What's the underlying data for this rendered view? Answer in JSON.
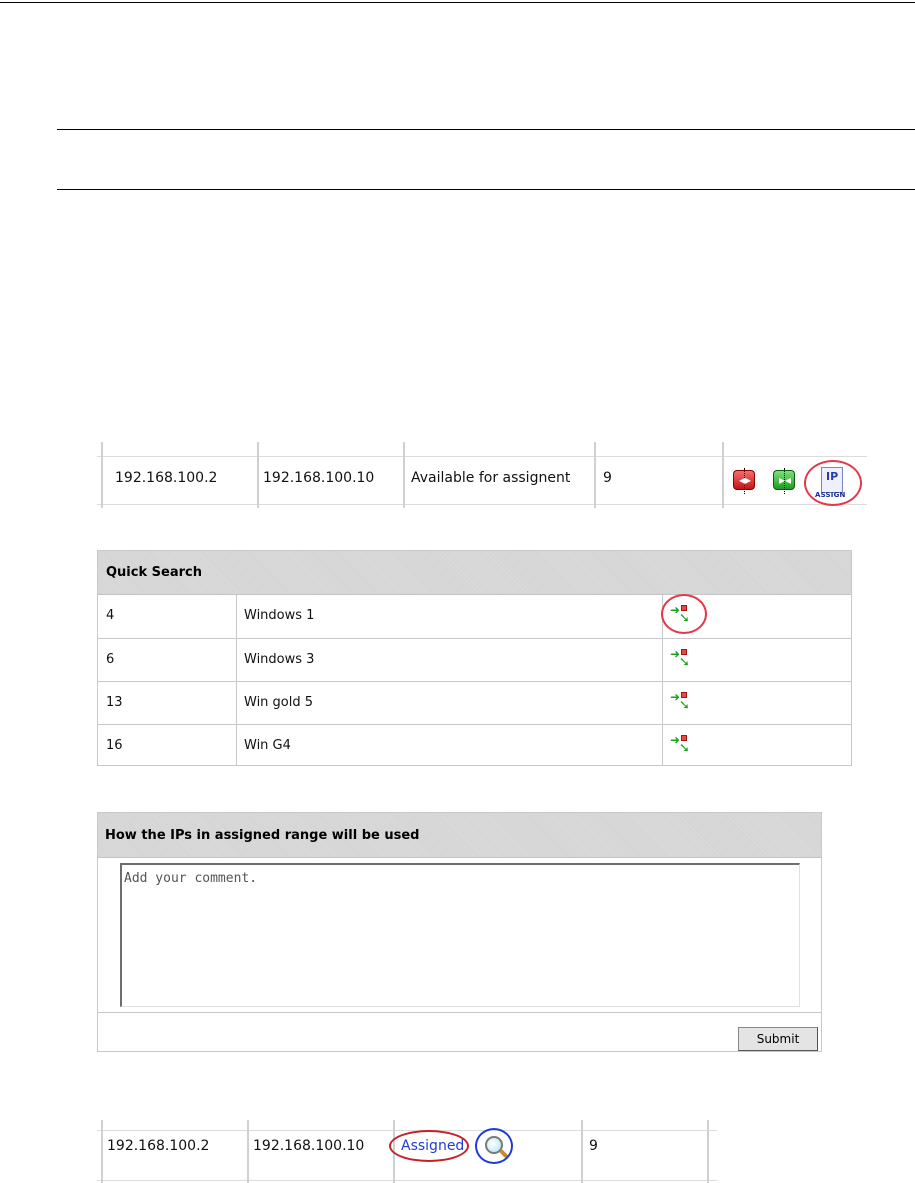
{
  "range_row_top": {
    "start_ip": "192.168.100.2",
    "end_ip": "192.168.100.10",
    "status": "Available for assignent",
    "count": "9",
    "actions": [
      {
        "icon": "delete-range-icon",
        "color": "#c41414"
      },
      {
        "icon": "split-range-icon",
        "color": "#1f9a1f"
      },
      {
        "icon": "ip-assign-icon",
        "label_top": "IP",
        "label_bottom": "ASSIGN"
      }
    ],
    "highlight_color": "#e23a4b"
  },
  "quick_search": {
    "title": "Quick Search",
    "rows": [
      {
        "id": "4",
        "name": "Windows 1",
        "action_icon": "select-arrow-icon"
      },
      {
        "id": "6",
        "name": "Windows 3",
        "action_icon": "select-arrow-icon"
      },
      {
        "id": "13",
        "name": "Win gold 5",
        "action_icon": "select-arrow-icon"
      },
      {
        "id": "16",
        "name": "Win G4",
        "action_icon": "select-arrow-icon"
      }
    ]
  },
  "usage": {
    "title": "How the IPs in assigned range will be used",
    "comment_placeholder": "Add your comment.",
    "submit_label": "Submit"
  },
  "range_row_bottom": {
    "start_ip": "192.168.100.2",
    "end_ip": "192.168.100.10",
    "status": "Assigned",
    "count": "9",
    "status_color": "#1f3bd6",
    "action_icon": "magnifier-icon",
    "highlight_colors": [
      "#c4222b",
      "#1f3bd6"
    ]
  }
}
